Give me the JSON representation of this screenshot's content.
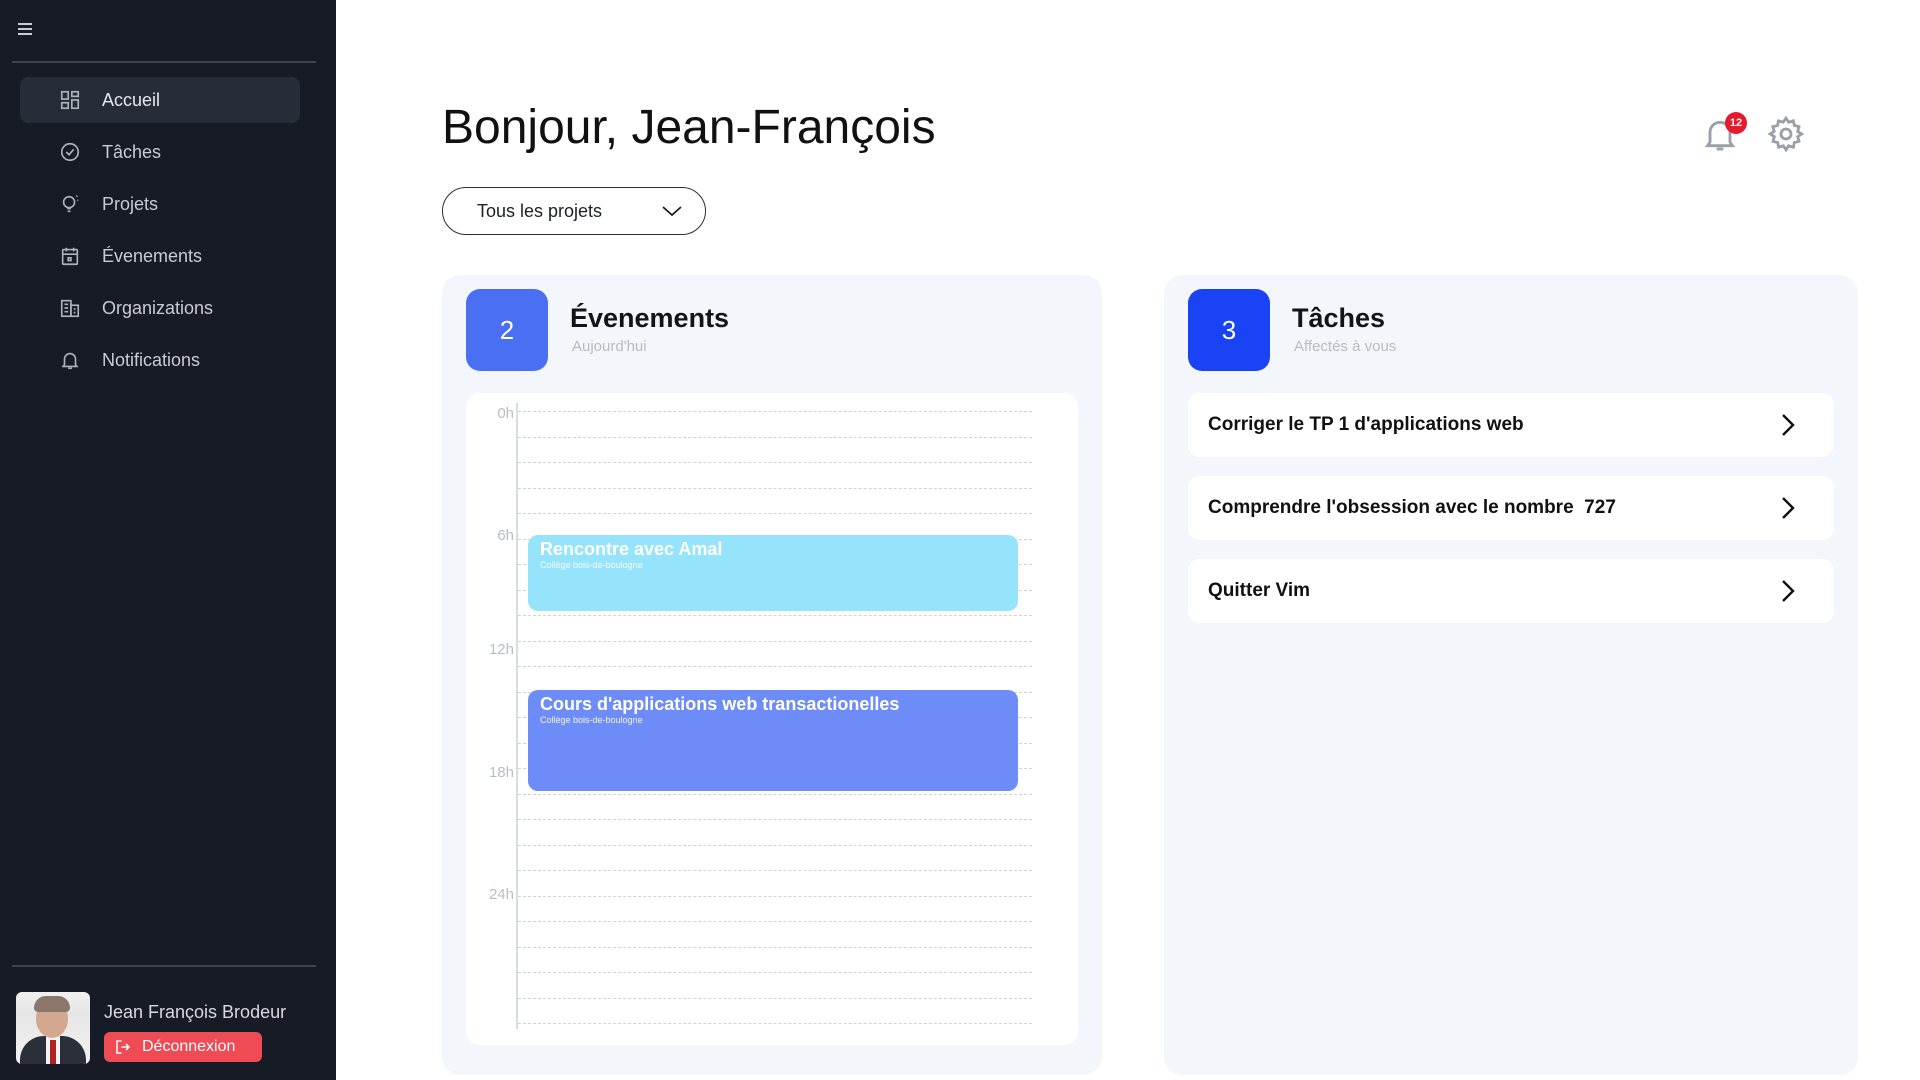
{
  "sidebar": {
    "items": [
      {
        "label": "Accueil",
        "icon": "dashboard-icon",
        "active": true
      },
      {
        "label": "Tâches",
        "icon": "check-circle-icon"
      },
      {
        "label": "Projets",
        "icon": "lightbulb-icon"
      },
      {
        "label": "Évenements",
        "icon": "calendar-icon"
      },
      {
        "label": "Organizations",
        "icon": "building-icon"
      },
      {
        "label": "Notifications",
        "icon": "bell-icon"
      }
    ],
    "user": {
      "name": "Jean François Brodeur",
      "logout_label": "Déconnexion"
    }
  },
  "header": {
    "greeting": "Bonjour, Jean-François",
    "notification_count": "12",
    "project_filter": "Tous les projets"
  },
  "events_card": {
    "count": "2",
    "title": "Évenements",
    "subtitle": "Aujourd'hui",
    "hour_labels": [
      "0h",
      "6h",
      "12h",
      "18h",
      "24h"
    ],
    "events": [
      {
        "title": "Rencontre avec Amal",
        "location": "Collège bois-de-boulogne",
        "color": "#95e4fb"
      },
      {
        "title": "Cours d'applications web transactionelles",
        "location": "Collège bois-de-boulogne",
        "color": "#6e8cf8"
      }
    ]
  },
  "tasks_card": {
    "count": "3",
    "title": "Tâches",
    "subtitle": "Affectés à vous",
    "tasks": [
      {
        "label": "Corriger le TP 1 d'applications web"
      },
      {
        "label": "Comprendre l'obsession avec le nombre  727"
      },
      {
        "label": "Quitter Vim"
      }
    ]
  },
  "colors": {
    "sidebar_bg": "#161b26",
    "accent_blue": "#1a43f5",
    "logout_red": "#ef4b55",
    "badge_red": "#e51b2b"
  }
}
